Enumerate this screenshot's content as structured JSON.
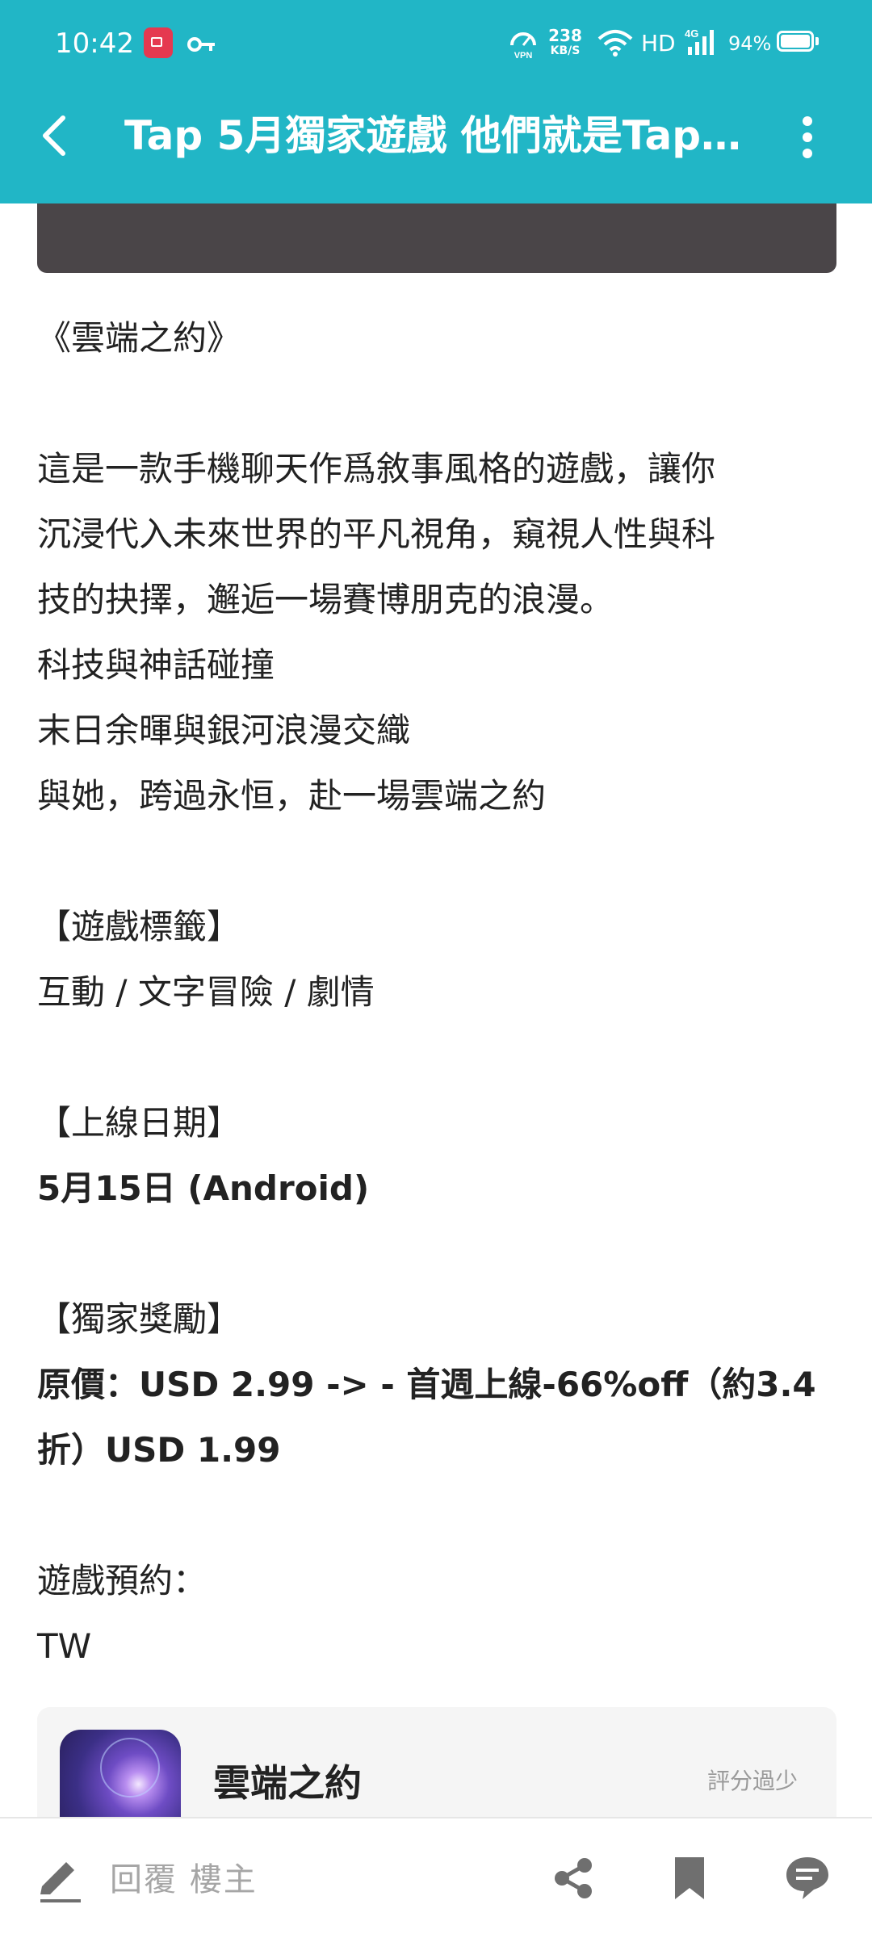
{
  "status_bar": {
    "time": "10:42",
    "net_speed_value": "238",
    "net_speed_unit": "KB/S",
    "network_type": "HD",
    "battery_percent": "94%"
  },
  "header": {
    "title": "Tap 5月獨家遊戲 他們就是Tap…"
  },
  "article": {
    "lines": [
      "《雲端之約》",
      "",
      "這是一款手機聊天作爲敘事風格的遊戲，讓你",
      "沉浸代入未來世界的平凡視角，窺視人性與科",
      "技的抉擇，邂逅一場賽博朋克的浪漫。",
      "科技與神話碰撞",
      "末日余暉與銀河浪漫交織",
      "與她，跨過永恒，赴一場雲端之約",
      "",
      "【遊戲標籤】",
      "互動 / 文字冒險 / 劇情",
      "",
      "【上線日期】",
      "5月15日 (Android)",
      "",
      "【獨家獎勵】",
      "原價：USD 2.99 -> - 首週上線-66%off（約3.4",
      "折）USD 1.99",
      "",
      "遊戲預約：",
      "TW"
    ]
  },
  "game_card": {
    "name": "雲端之約",
    "rating_text": "評分過少"
  },
  "bottom_bar": {
    "reply_label": "回覆  樓主"
  },
  "colors": {
    "accent": "#21b6c6",
    "text": "#222222",
    "muted": "#a6a6a6"
  }
}
